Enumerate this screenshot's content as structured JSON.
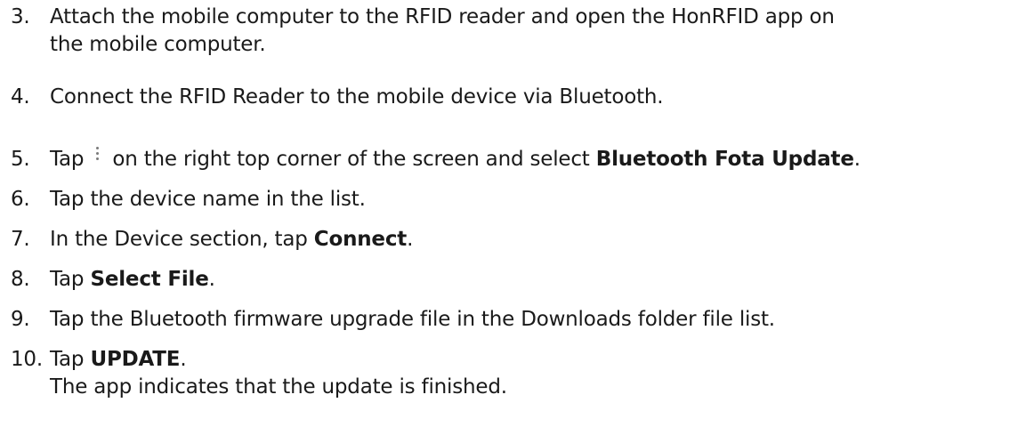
{
  "steps": [
    {
      "number": "3.",
      "lines": [
        "Attach the mobile computer to the RFID reader and open the HonRFID app on",
        "the mobile computer."
      ]
    },
    {
      "number": "4.",
      "text": "Connect the RFID Reader to the mobile device via Bluetooth."
    },
    {
      "number": "5.",
      "prefix": "Tap",
      "icon": "more-vertical-icon",
      "middle": "on the right top corner of the screen and select",
      "bold": "Bluetooth Fota Update",
      "suffix": "."
    },
    {
      "number": "6.",
      "text": "Tap the device name in the list."
    },
    {
      "number": "7.",
      "prefix": "In the Device section, tap",
      "bold": "Connect",
      "suffix": "."
    },
    {
      "number": "8.",
      "prefix": "Tap",
      "bold": "Select File",
      "suffix": "."
    },
    {
      "number": "9.",
      "text": "Tap the Bluetooth firmware upgrade file in the Downloads folder file list."
    },
    {
      "number": "10.",
      "prefix": "Tap",
      "bold": "UPDATE",
      "suffix": ".",
      "result": "The app indicates that the update is finished."
    }
  ]
}
